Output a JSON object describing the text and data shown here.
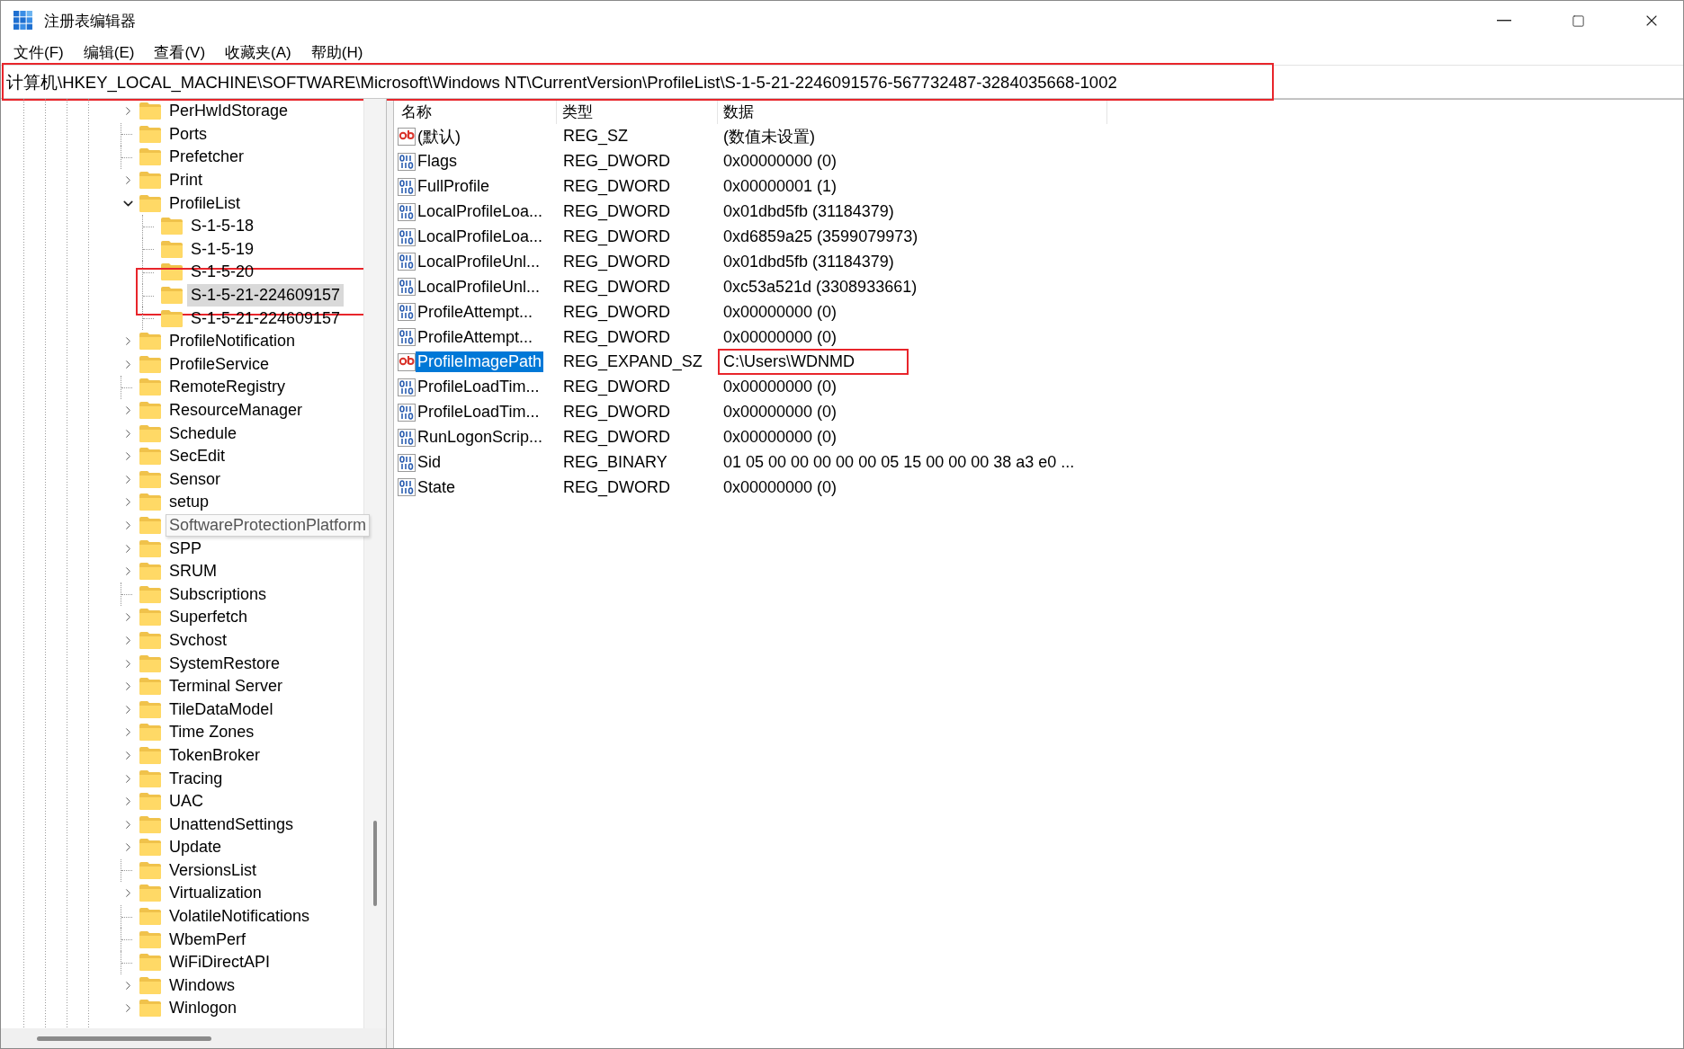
{
  "window": {
    "title": "注册表编辑器"
  },
  "menu": [
    {
      "label": "文件(F)"
    },
    {
      "label": "编辑(E)"
    },
    {
      "label": "查看(V)"
    },
    {
      "label": "收藏夹(A)"
    },
    {
      "label": "帮助(H)"
    }
  ],
  "address": {
    "path": "计算机\\HKEY_LOCAL_MACHINE\\SOFTWARE\\Microsoft\\Windows NT\\CurrentVersion\\ProfileList\\S-1-5-21-2246091576-567732487-3284035668-1002",
    "highlighted": true
  },
  "tree": {
    "items": [
      {
        "label": "PerHwIdStorage",
        "expandable": true,
        "expanded": false,
        "selected": false,
        "hovered": false,
        "highlighted": false
      },
      {
        "label": "Ports",
        "expandable": false,
        "selected": false,
        "hovered": false,
        "highlighted": false
      },
      {
        "label": "Prefetcher",
        "expandable": false,
        "selected": false,
        "hovered": false,
        "highlighted": false
      },
      {
        "label": "Print",
        "expandable": true,
        "expanded": false,
        "selected": false,
        "hovered": false,
        "highlighted": false
      },
      {
        "label": "ProfileList",
        "expandable": true,
        "expanded": true,
        "selected": false,
        "hovered": false,
        "highlighted": false,
        "children": [
          {
            "label": "S-1-5-18",
            "expandable": false,
            "selected": false,
            "hovered": false,
            "highlighted": false
          },
          {
            "label": "S-1-5-19",
            "expandable": false,
            "selected": false,
            "hovered": false,
            "highlighted": false
          },
          {
            "label": "S-1-5-20",
            "expandable": false,
            "selected": false,
            "hovered": false,
            "highlighted": false
          },
          {
            "label": "S-1-5-21-224609157",
            "expandable": false,
            "selected": true,
            "hovered": false,
            "highlighted": true
          },
          {
            "label": "S-1-5-21-224609157",
            "expandable": false,
            "selected": false,
            "hovered": false,
            "highlighted": false
          }
        ]
      },
      {
        "label": "ProfileNotification",
        "expandable": true,
        "expanded": false,
        "selected": false,
        "hovered": false,
        "highlighted": false
      },
      {
        "label": "ProfileService",
        "expandable": true,
        "expanded": false,
        "selected": false,
        "hovered": false,
        "highlighted": false
      },
      {
        "label": "RemoteRegistry",
        "expandable": false,
        "selected": false,
        "hovered": false,
        "highlighted": false
      },
      {
        "label": "ResourceManager",
        "expandable": true,
        "expanded": false,
        "selected": false,
        "hovered": false,
        "highlighted": false
      },
      {
        "label": "Schedule",
        "expandable": true,
        "expanded": false,
        "selected": false,
        "hovered": false,
        "highlighted": false
      },
      {
        "label": "SecEdit",
        "expandable": true,
        "expanded": false,
        "selected": false,
        "hovered": false,
        "highlighted": false
      },
      {
        "label": "Sensor",
        "expandable": true,
        "expanded": false,
        "selected": false,
        "hovered": false,
        "highlighted": false
      },
      {
        "label": "setup",
        "expandable": true,
        "expanded": false,
        "selected": false,
        "hovered": false,
        "highlighted": false
      },
      {
        "label": "SoftwareProtectionPlatform",
        "expandable": true,
        "expanded": false,
        "selected": false,
        "hovered": true,
        "highlighted": false
      },
      {
        "label": "SPP",
        "expandable": true,
        "expanded": false,
        "selected": false,
        "hovered": false,
        "highlighted": false
      },
      {
        "label": "SRUM",
        "expandable": true,
        "expanded": false,
        "selected": false,
        "hovered": false,
        "highlighted": false
      },
      {
        "label": "Subscriptions",
        "expandable": false,
        "selected": false,
        "hovered": false,
        "highlighted": false
      },
      {
        "label": "Superfetch",
        "expandable": true,
        "expanded": false,
        "selected": false,
        "hovered": false,
        "highlighted": false
      },
      {
        "label": "Svchost",
        "expandable": true,
        "expanded": false,
        "selected": false,
        "hovered": false,
        "highlighted": false
      },
      {
        "label": "SystemRestore",
        "expandable": true,
        "expanded": false,
        "selected": false,
        "hovered": false,
        "highlighted": false
      },
      {
        "label": "Terminal Server",
        "expandable": true,
        "expanded": false,
        "selected": false,
        "hovered": false,
        "highlighted": false
      },
      {
        "label": "TileDataModel",
        "expandable": true,
        "expanded": false,
        "selected": false,
        "hovered": false,
        "highlighted": false
      },
      {
        "label": "Time Zones",
        "expandable": true,
        "expanded": false,
        "selected": false,
        "hovered": false,
        "highlighted": false
      },
      {
        "label": "TokenBroker",
        "expandable": true,
        "expanded": false,
        "selected": false,
        "hovered": false,
        "highlighted": false
      },
      {
        "label": "Tracing",
        "expandable": true,
        "expanded": false,
        "selected": false,
        "hovered": false,
        "highlighted": false
      },
      {
        "label": "UAC",
        "expandable": true,
        "expanded": false,
        "selected": false,
        "hovered": false,
        "highlighted": false
      },
      {
        "label": "UnattendSettings",
        "expandable": true,
        "expanded": false,
        "selected": false,
        "hovered": false,
        "highlighted": false
      },
      {
        "label": "Update",
        "expandable": true,
        "expanded": false,
        "selected": false,
        "hovered": false,
        "highlighted": false
      },
      {
        "label": "VersionsList",
        "expandable": false,
        "selected": false,
        "hovered": false,
        "highlighted": false
      },
      {
        "label": "Virtualization",
        "expandable": true,
        "expanded": false,
        "selected": false,
        "hovered": false,
        "highlighted": false
      },
      {
        "label": "VolatileNotifications",
        "expandable": false,
        "selected": false,
        "hovered": false,
        "highlighted": false
      },
      {
        "label": "WbemPerf",
        "expandable": false,
        "selected": false,
        "hovered": false,
        "highlighted": false
      },
      {
        "label": "WiFiDirectAPI",
        "expandable": false,
        "selected": false,
        "hovered": false,
        "highlighted": false
      },
      {
        "label": "Windows",
        "expandable": true,
        "expanded": false,
        "selected": false,
        "hovered": false,
        "highlighted": false
      },
      {
        "label": "Winlogon",
        "expandable": true,
        "expanded": false,
        "selected": false,
        "hovered": false,
        "highlighted": false
      }
    ]
  },
  "values": {
    "columns": [
      "名称",
      "类型",
      "数据"
    ],
    "rows": [
      {
        "kind": "string",
        "name": "(默认)",
        "type": "REG_SZ",
        "data": "(数值未设置)",
        "selected": false,
        "highlighted": false
      },
      {
        "kind": "binary",
        "name": "Flags",
        "type": "REG_DWORD",
        "data": "0x00000000 (0)",
        "selected": false,
        "highlighted": false
      },
      {
        "kind": "binary",
        "name": "FullProfile",
        "type": "REG_DWORD",
        "data": "0x00000001 (1)",
        "selected": false,
        "highlighted": false
      },
      {
        "kind": "binary",
        "name": "LocalProfileLoa...",
        "type": "REG_DWORD",
        "data": "0x01dbd5fb (31184379)",
        "selected": false,
        "highlighted": false
      },
      {
        "kind": "binary",
        "name": "LocalProfileLoa...",
        "type": "REG_DWORD",
        "data": "0xd6859a25 (3599079973)",
        "selected": false,
        "highlighted": false
      },
      {
        "kind": "binary",
        "name": "LocalProfileUnl...",
        "type": "REG_DWORD",
        "data": "0x01dbd5fb (31184379)",
        "selected": false,
        "highlighted": false
      },
      {
        "kind": "binary",
        "name": "LocalProfileUnl...",
        "type": "REG_DWORD",
        "data": "0xc53a521d (3308933661)",
        "selected": false,
        "highlighted": false
      },
      {
        "kind": "binary",
        "name": "ProfileAttempt...",
        "type": "REG_DWORD",
        "data": "0x00000000 (0)",
        "selected": false,
        "highlighted": false
      },
      {
        "kind": "binary",
        "name": "ProfileAttempt...",
        "type": "REG_DWORD",
        "data": "0x00000000 (0)",
        "selected": false,
        "highlighted": false
      },
      {
        "kind": "string",
        "name": "ProfileImagePath",
        "type": "REG_EXPAND_SZ",
        "data": "C:\\Users\\WDNMD",
        "selected": true,
        "highlighted": true
      },
      {
        "kind": "binary",
        "name": "ProfileLoadTim...",
        "type": "REG_DWORD",
        "data": "0x00000000 (0)",
        "selected": false,
        "highlighted": false
      },
      {
        "kind": "binary",
        "name": "ProfileLoadTim...",
        "type": "REG_DWORD",
        "data": "0x00000000 (0)",
        "selected": false,
        "highlighted": false
      },
      {
        "kind": "binary",
        "name": "RunLogonScrip...",
        "type": "REG_DWORD",
        "data": "0x00000000 (0)",
        "selected": false,
        "highlighted": false
      },
      {
        "kind": "binary",
        "name": "Sid",
        "type": "REG_BINARY",
        "data": "01 05 00 00 00 00 00 05 15 00 00 00 38 a3 e0 ...",
        "selected": false,
        "highlighted": false
      },
      {
        "kind": "binary",
        "name": "State",
        "type": "REG_DWORD",
        "data": "0x00000000 (0)",
        "selected": false,
        "highlighted": false
      }
    ]
  }
}
